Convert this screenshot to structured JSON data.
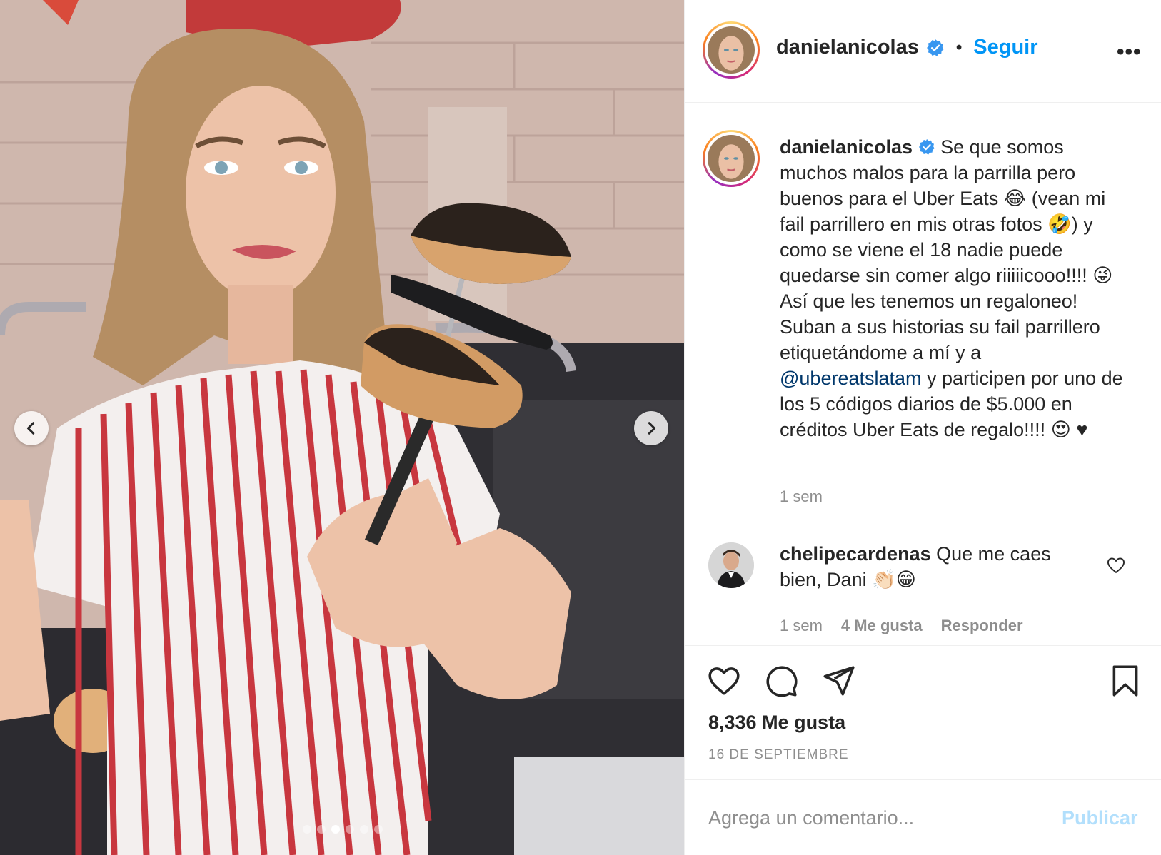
{
  "post": {
    "username": "danielanicolas",
    "follow_label": "Seguir",
    "separator": "•",
    "more_label": "•••",
    "caption_pre_mention": "Se que somos muchos malos para la parrilla pero buenos para el Uber Eats 😂 (vean mi fail parrillero en mis otras fotos 🤣) y como se viene el 18 nadie puede quedarse sin comer algo riiiiicooo!!!! 😜 Así que les tenemos un regaloneo! Suban a sus historias su fail parrillero etiquetándome a mí y a",
    "mention": "@ubereatslatam",
    "caption_post_mention": " y participen por uno de los 5 códigos diarios de $5.000 en créditos Uber Eats de regalo!!!! 😍 ♥",
    "caption_time": "1 sem",
    "likes_label": "8,336 Me gusta",
    "date_label": "16 DE SEPTIEMBRE",
    "carousel": {
      "total": 6,
      "active_index": 2
    }
  },
  "comment": {
    "username": "chelipecardenas",
    "text": "Que me caes bien, Dani 👏🏻😁",
    "time": "1 sem",
    "likes": "4 Me gusta",
    "reply_label": "Responder"
  },
  "composer": {
    "placeholder": "Agrega un comentario...",
    "publish_label": "Publicar"
  },
  "icons": {
    "prev": "chevron-left-icon",
    "next": "chevron-right-icon",
    "like": "heart-icon",
    "comment": "comment-bubble-icon",
    "share": "paper-plane-icon",
    "save": "bookmark-icon",
    "verified": "verified-badge-icon"
  },
  "colors": {
    "link_blue": "#0095f6",
    "mention": "#00376b",
    "secondary_text": "#8e8e8e",
    "publish_disabled": "#b2dffc"
  }
}
